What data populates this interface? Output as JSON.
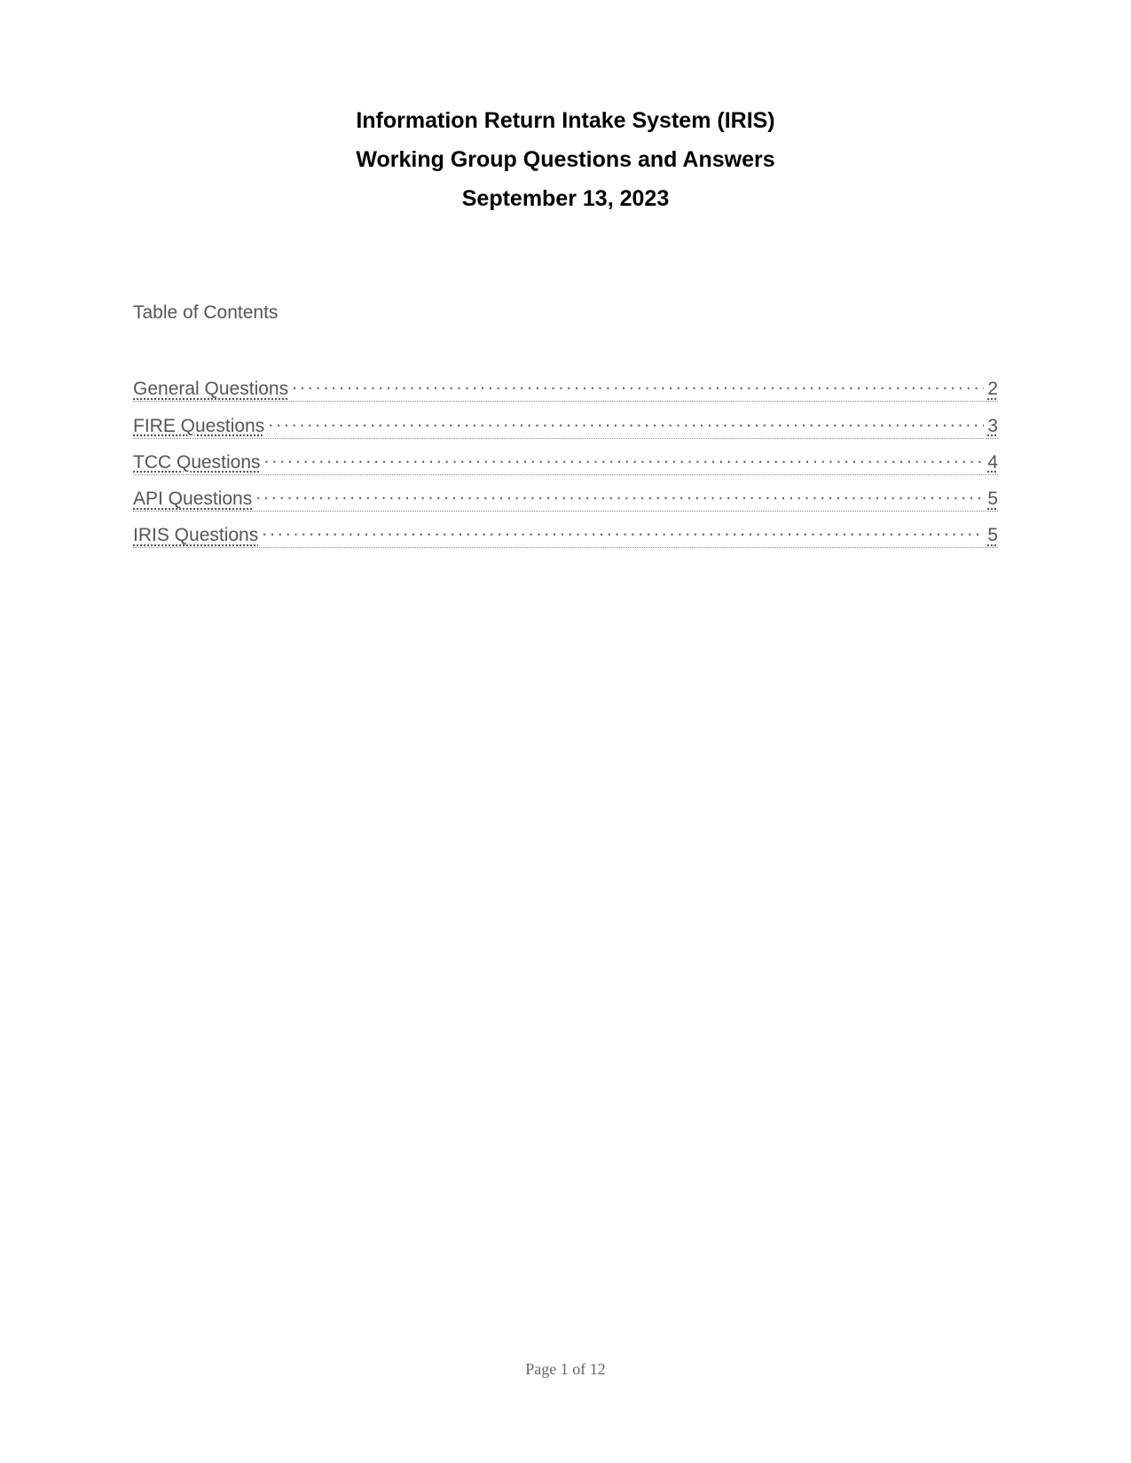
{
  "title": {
    "line1": "Information Return Intake System (IRIS)",
    "line2": "Working Group Questions and Answers",
    "line3": "September 13, 2023"
  },
  "toc": {
    "heading": "Table of Contents",
    "items": [
      {
        "label": "General Questions",
        "page": "2"
      },
      {
        "label": "FIRE Questions",
        "page": "3"
      },
      {
        "label": "TCC Questions",
        "page": "4"
      },
      {
        "label": "API Questions",
        "page": "5"
      },
      {
        "label": "IRIS Questions",
        "page": "5"
      }
    ]
  },
  "footer": {
    "text": "Page 1 of 12"
  }
}
